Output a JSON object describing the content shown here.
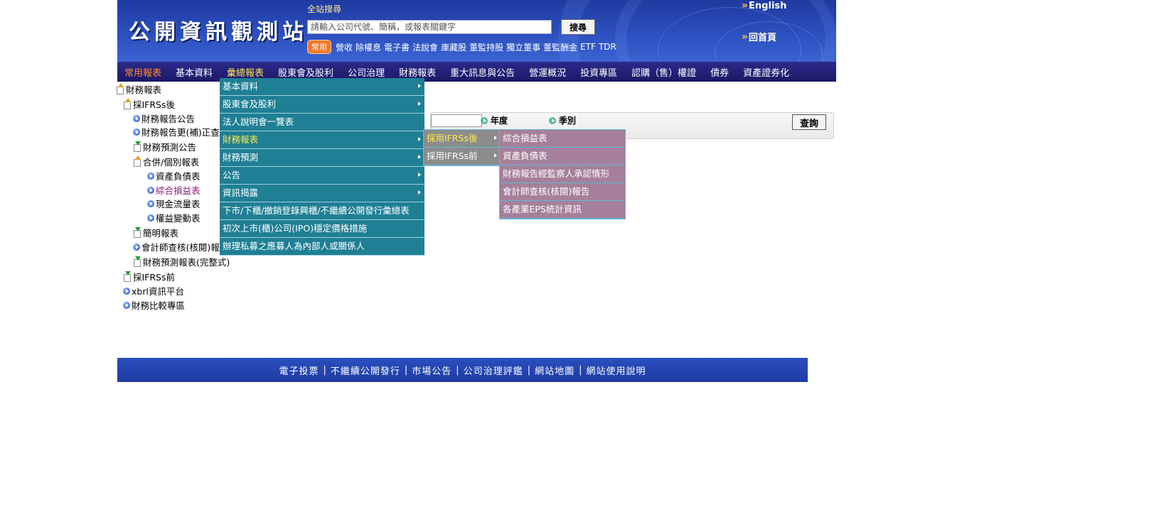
{
  "header": {
    "logo_text": "公開資訊觀測站",
    "search_title": "全站搜尋",
    "search_placeholder": "請輸入公司代號、簡稱，或報表關鍵字",
    "search_button": "搜尋",
    "common_badge": "常用",
    "quick_links": [
      "營收",
      "除權息",
      "電子書",
      "法說會",
      "庫藏股",
      "董監持股",
      "獨立董事",
      "董監酬金",
      "ETF",
      "TDR"
    ],
    "english_link": "English",
    "home_link": "回首頁"
  },
  "main_nav": {
    "items": [
      "常用報表",
      "基本資料",
      "彙總報表",
      "股東會及股利",
      "公司治理",
      "財務報表",
      "重大訊息與公告",
      "營運概況",
      "投資專區",
      "認購（售）權證",
      "債券",
      "資產證券化"
    ]
  },
  "sidebar": {
    "nodes": [
      "財務報表",
      "採IFRSs後",
      "財務報告公告",
      "財務報告更(補)正查",
      "財務預測公告",
      "合併/個別報表",
      "資產負債表",
      "綜合損益表",
      "現金流量表",
      "權益變動表",
      "簡明報表",
      "會計師查核(核閱)報",
      "財務預測報表(完整式)",
      "採IFRSs前",
      "xbrl資訊平台",
      "財務比較專區"
    ],
    "active": "綜合損益表"
  },
  "query": {
    "year_label": "年度",
    "season_label": "季別",
    "query_button": "查詢"
  },
  "menus": {
    "level1": [
      "基本資料",
      "股東會及股利",
      "法人說明會一覽表",
      "財務報表",
      "財務預測",
      "公告",
      "資訊揭露",
      "下市/下櫃/撤銷登錄興櫃/不繼續公開發行彙總表",
      "初次上市(櫃)公司(IPO)穩定價格措施",
      "辦理私募之應募人為內部人或關係人"
    ],
    "level2": [
      "採用IFRSs後",
      "採用IFRSs前"
    ],
    "level3": [
      "綜合損益表",
      "資產負債表",
      "財務報告經監察人承認情形",
      "會計師查核(核閱)報告",
      "各產業EPS統計資訊"
    ]
  },
  "footer": {
    "links": [
      "電子投票",
      "不繼續公開發行",
      "市場公告",
      "公司治理評鑑",
      "網站地圖",
      "網站使用說明"
    ]
  },
  "colors": {
    "header_blue": "#2c4fbf",
    "nav_dark": "#1a1866",
    "menu_teal": "#1f7f95",
    "submenu_gray": "#8c8c8c",
    "submenu_mauve": "#a6809a",
    "highlight_yellow": "#ffe94a",
    "highlight_orange": "#ff8a2a"
  }
}
